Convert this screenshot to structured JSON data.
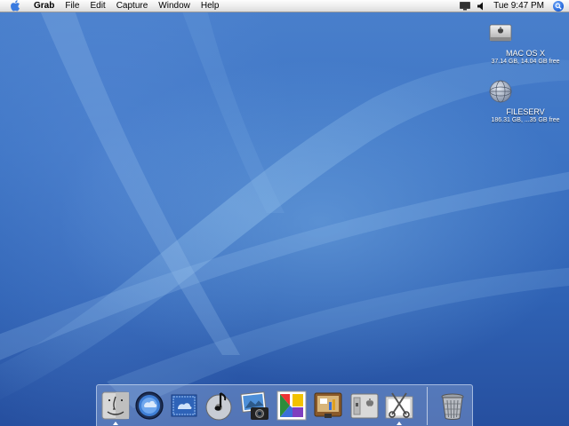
{
  "menubar": {
    "apple_icon": "apple-icon",
    "items": [
      "Grab",
      "File",
      "Edit",
      "Capture",
      "Window",
      "Help"
    ],
    "clock": "Tue 9:47 PM",
    "extras": [
      "display-icon",
      "volume-icon",
      "spotlight-icon"
    ]
  },
  "desktop": {
    "disks": [
      {
        "name": "MAC OS X",
        "info": "37.14 GB, 14.04 GB free",
        "icon": "hard-disk-icon"
      },
      {
        "name": "FILESERV",
        "info": "186.31 GB, ...35 GB free",
        "icon": "network-disk-icon"
      }
    ]
  },
  "dock": {
    "items": [
      {
        "name": "Finder",
        "icon": "finder-icon",
        "running": true
      },
      {
        "name": "Dashboard",
        "icon": "dashboard-icon",
        "running": false
      },
      {
        "name": "Mail",
        "icon": "mail-icon",
        "running": false
      },
      {
        "name": "iTunes",
        "icon": "itunes-icon",
        "running": false
      },
      {
        "name": "iPhoto",
        "icon": "iphoto-icon",
        "running": false
      },
      {
        "name": "Preview",
        "icon": "preview-icon",
        "running": false
      },
      {
        "name": "Keynote",
        "icon": "keynote-icon",
        "running": false
      },
      {
        "name": "System Preferences",
        "icon": "system-preferences-icon",
        "running": false
      },
      {
        "name": "Grab",
        "icon": "grab-icon",
        "running": true
      },
      {
        "name": "Trash",
        "icon": "trash-icon",
        "running": false
      }
    ]
  },
  "colors": {
    "wallpaper": "#3b6fc0",
    "menubar": "#ececec",
    "spotlight": "#1b5fd6"
  }
}
